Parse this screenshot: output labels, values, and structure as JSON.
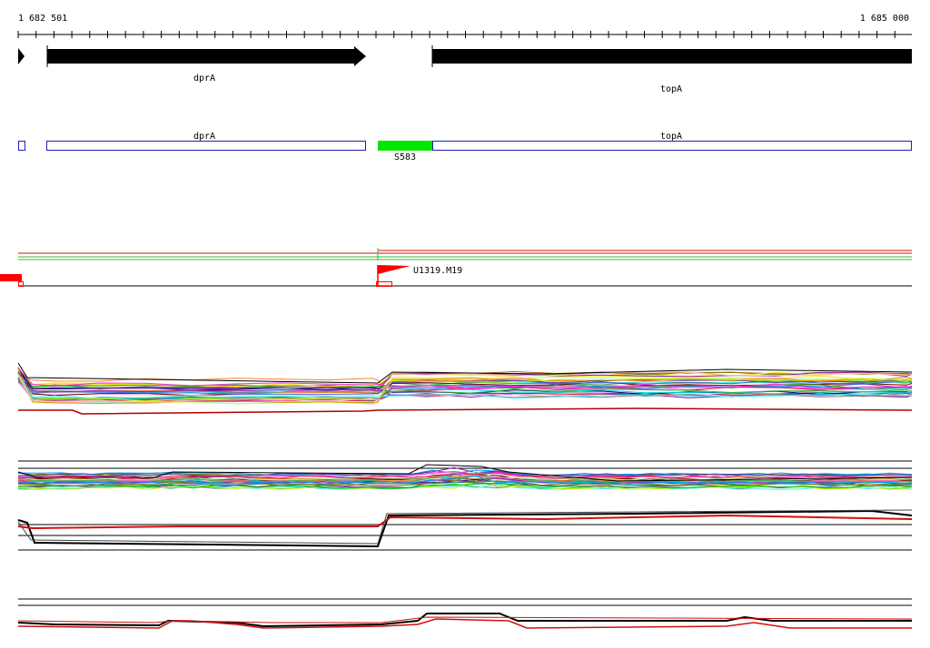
{
  "ruler": {
    "start_label": "1 682 501",
    "end_label": "1 685 000"
  },
  "genes": [
    {
      "name": "dprA",
      "label": "dprA"
    },
    {
      "name": "topA",
      "label": "topA"
    }
  ],
  "cds": [
    {
      "name": "dprA",
      "label": "dprA"
    },
    {
      "name": "topA",
      "label": "topA"
    }
  ],
  "features": {
    "green_feature_label": "S583",
    "flag_label": "U1319.M19"
  },
  "colors": {
    "gene_arrow": "#000000",
    "cds_outline": "#1f1fb0",
    "green_feature": "#00e600",
    "flag": "#ff0000",
    "track_green": "#3cb43c",
    "track_red": "#d01010"
  }
}
